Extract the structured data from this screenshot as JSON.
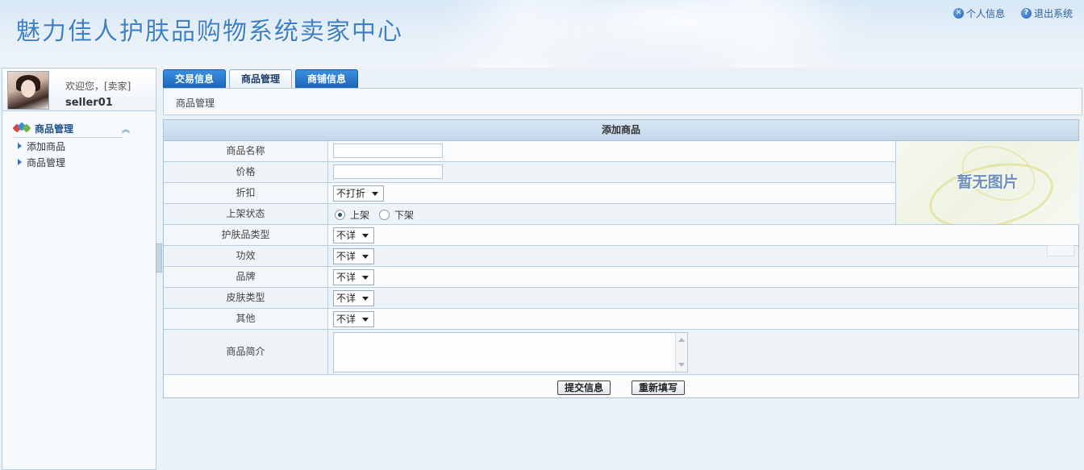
{
  "header": {
    "title": "魅力佳人护肤品购物系统卖家中心",
    "links": [
      {
        "label": "个人信息",
        "icon": "x-circle-icon",
        "glyph": "✕"
      },
      {
        "label": "退出系统",
        "icon": "question-circle-icon",
        "glyph": "?"
      }
    ]
  },
  "sidebar": {
    "welcome": "欢迎您，[卖家]",
    "username": "seller01",
    "group_title": "商品管理",
    "collapse_glyph": "︽",
    "items": [
      {
        "label": "添加商品"
      },
      {
        "label": "商品管理"
      }
    ]
  },
  "tabs": [
    {
      "label": "交易信息",
      "active": false
    },
    {
      "label": "商品管理",
      "active": true
    },
    {
      "label": "商铺信息",
      "active": false
    }
  ],
  "breadcrumb": "商品管理",
  "form": {
    "title": "添加商品",
    "name_label": "商品名称",
    "name_value": "",
    "price_label": "价格",
    "price_value": "",
    "discount_label": "折扣",
    "discount_value": "不打折",
    "status_label": "上架状态",
    "status_options": [
      "上架",
      "下架"
    ],
    "status_selected": "上架",
    "category_label": "护肤品类型",
    "category_value": "不详",
    "effect_label": "功效",
    "effect_value": "不详",
    "brand_label": "品牌",
    "brand_value": "不详",
    "skin_label": "皮肤类型",
    "skin_value": "不详",
    "other_label": "其他",
    "other_value": "不详",
    "desc_label": "商品简介",
    "desc_value": "",
    "no_image": "暂无图片",
    "submit_label": "提交信息",
    "reset_label": "重新填写"
  },
  "colors": {
    "accent": "#1a63b8",
    "title_blue": "#3d7fc8",
    "table_border": "#b8cde0"
  }
}
